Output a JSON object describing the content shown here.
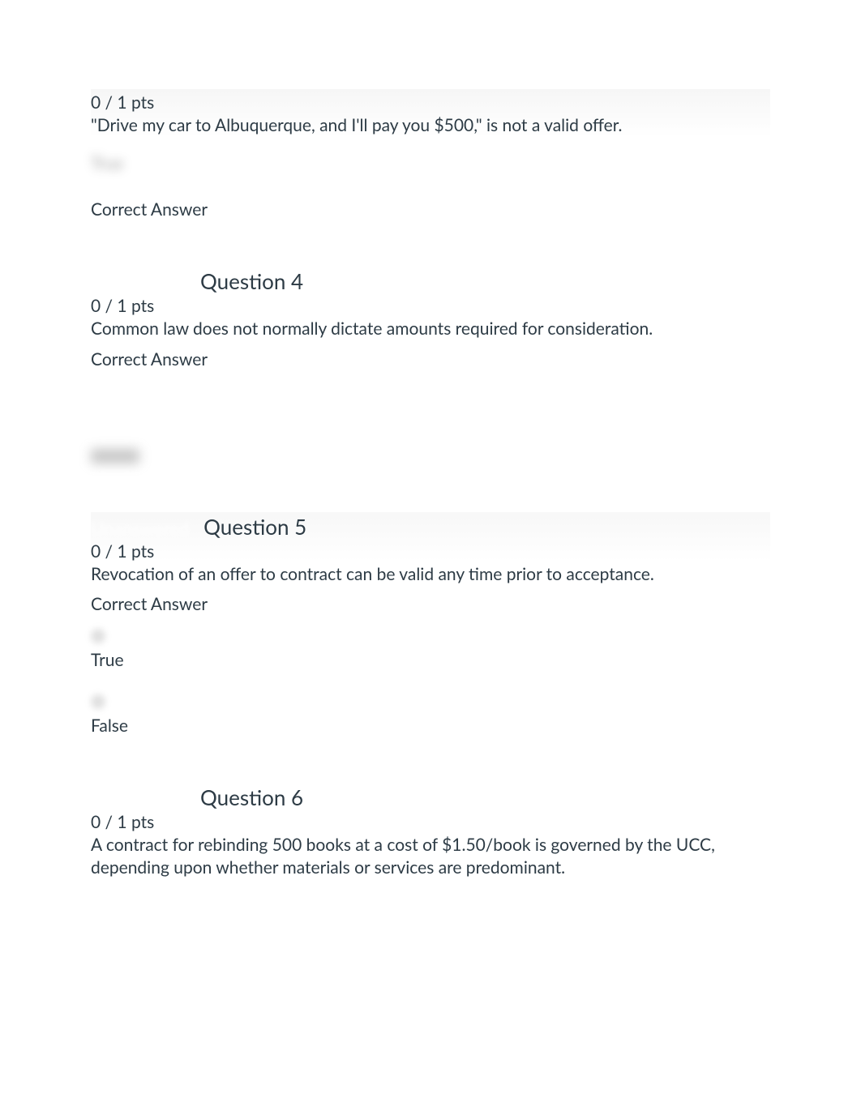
{
  "q3": {
    "points": "0 / 1 pts",
    "text": "\"Drive my car to Albuquerque, and I'll pay you $500,\" is not a valid offer.",
    "hidden_answer": "True",
    "correct_label": "Correct Answer"
  },
  "q4": {
    "title": "Question 4",
    "points": "0 / 1 pts",
    "text": "Common law does not normally dictate amounts required for consideration.",
    "correct_label": "Correct Answer"
  },
  "q5": {
    "unanswered": "Unanswered",
    "title": "Question 5",
    "points": "0 / 1 pts",
    "text": "Revocation of an offer to contract can be valid any time prior to acceptance.",
    "correct_label": "Correct Answer",
    "option_true": "True",
    "option_false": "False"
  },
  "q6": {
    "title": "Question 6",
    "points": "0 / 1 pts",
    "text": "A contract for rebinding 500 books at a cost of $1.50/book is governed by the UCC, depending upon whether materials or services are predominant."
  }
}
